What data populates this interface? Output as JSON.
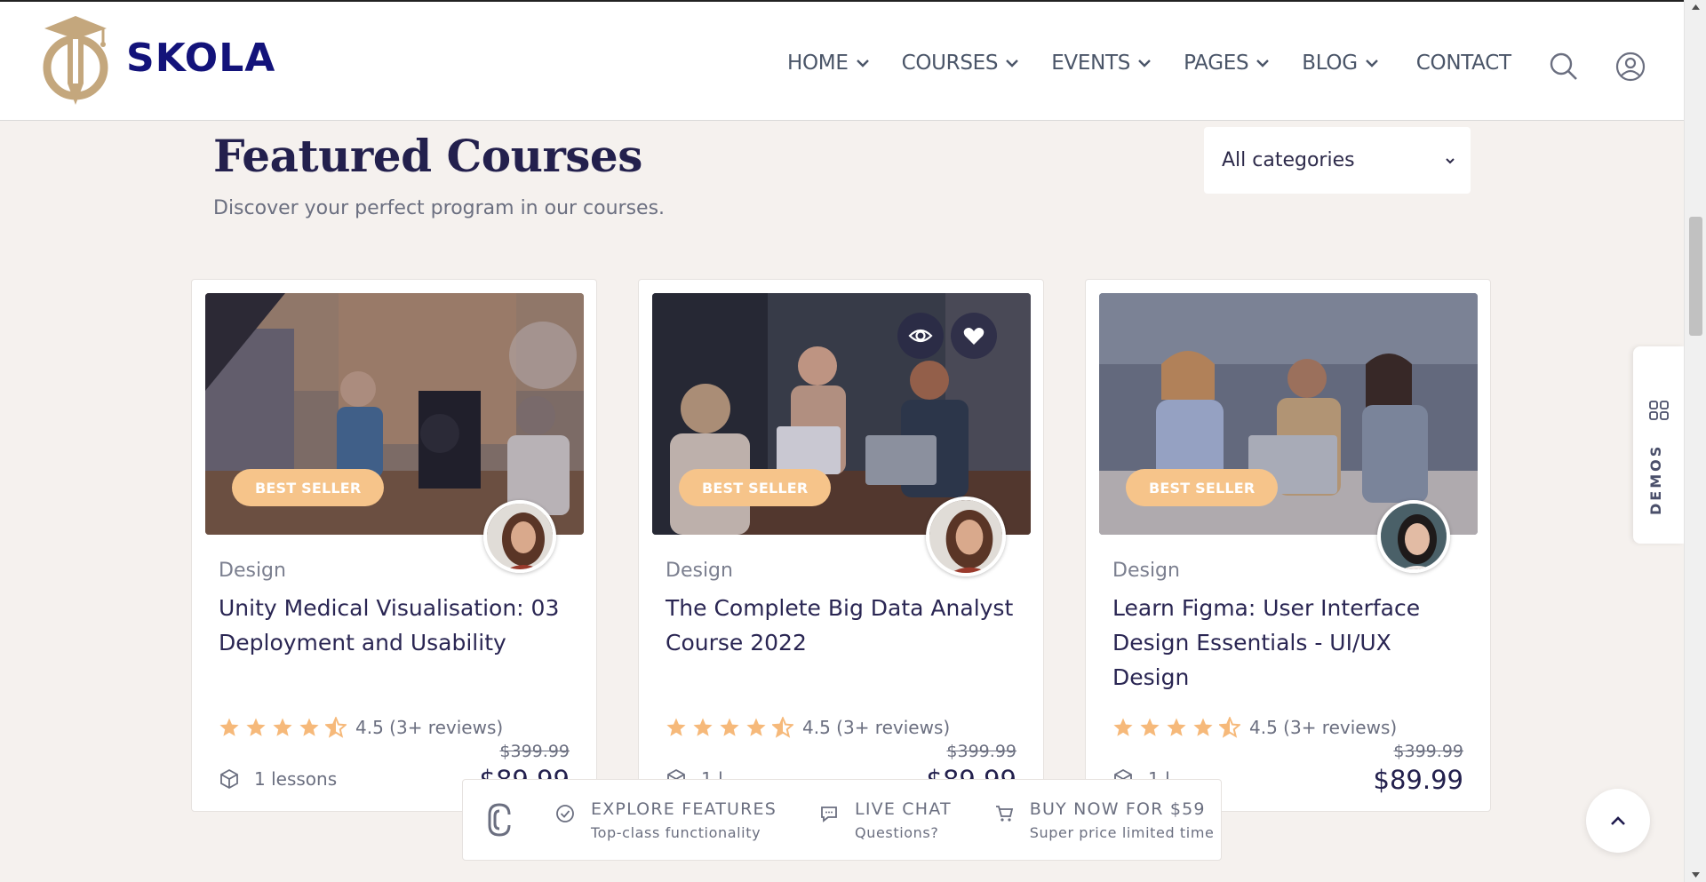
{
  "header": {
    "brand": "SKOLA",
    "nav": [
      {
        "label": "HOME",
        "has_dropdown": true
      },
      {
        "label": "COURSES",
        "has_dropdown": true
      },
      {
        "label": "EVENTS",
        "has_dropdown": true
      },
      {
        "label": "PAGES",
        "has_dropdown": true
      },
      {
        "label": "BLOG",
        "has_dropdown": true
      },
      {
        "label": "CONTACT",
        "has_dropdown": false
      }
    ],
    "icons": [
      "search-icon",
      "user-icon"
    ]
  },
  "section": {
    "title": "Featured Courses",
    "subtitle": "Discover your perfect program in our courses.",
    "category_select": "All categories"
  },
  "cards": [
    {
      "badge": "BEST SELLER",
      "category": "Design",
      "title": "Unity Medical Visualisation: 03 Deployment and Usability",
      "rating": 4.5,
      "rating_text": "4.5 (3+ reviews)",
      "old_price": "$399.99",
      "price": "$89.99",
      "lessons": "1 lessons"
    },
    {
      "badge": "BEST SELLER",
      "category": "Design",
      "title": "The Complete Big Data Analyst Course 2022",
      "rating": 4.5,
      "rating_text": "4.5 (3+ reviews)",
      "old_price": "$399.99",
      "price": "$89.99",
      "lessons": "1 l"
    },
    {
      "badge": "BEST SELLER",
      "category": "Design",
      "title": "Learn Figma: User Interface Design Essentials - UI/UX Design",
      "rating": 4.5,
      "rating_text": "4.5 (3+ reviews)",
      "old_price": "$399.99",
      "price": "$89.99",
      "lessons": "1 l"
    }
  ],
  "bottom_bar": {
    "items": [
      {
        "label": "EXPLORE FEATURES",
        "sub": "Top-class functionality",
        "icon": "check-circle-icon"
      },
      {
        "label": "LIVE CHAT",
        "sub": "Questions?",
        "icon": "chat-icon"
      },
      {
        "label": "BUY NOW FOR $59",
        "sub": "Super price limited time",
        "icon": "cart-icon"
      }
    ]
  },
  "side": {
    "demos_label": "DEMOS"
  },
  "colors": {
    "page_bg": "#f5f1ee",
    "brand_navy": "#13137a",
    "badge_orange": "#f6c48a",
    "star_orange": "#f6b97a",
    "logo_gold": "#c4a77d"
  }
}
